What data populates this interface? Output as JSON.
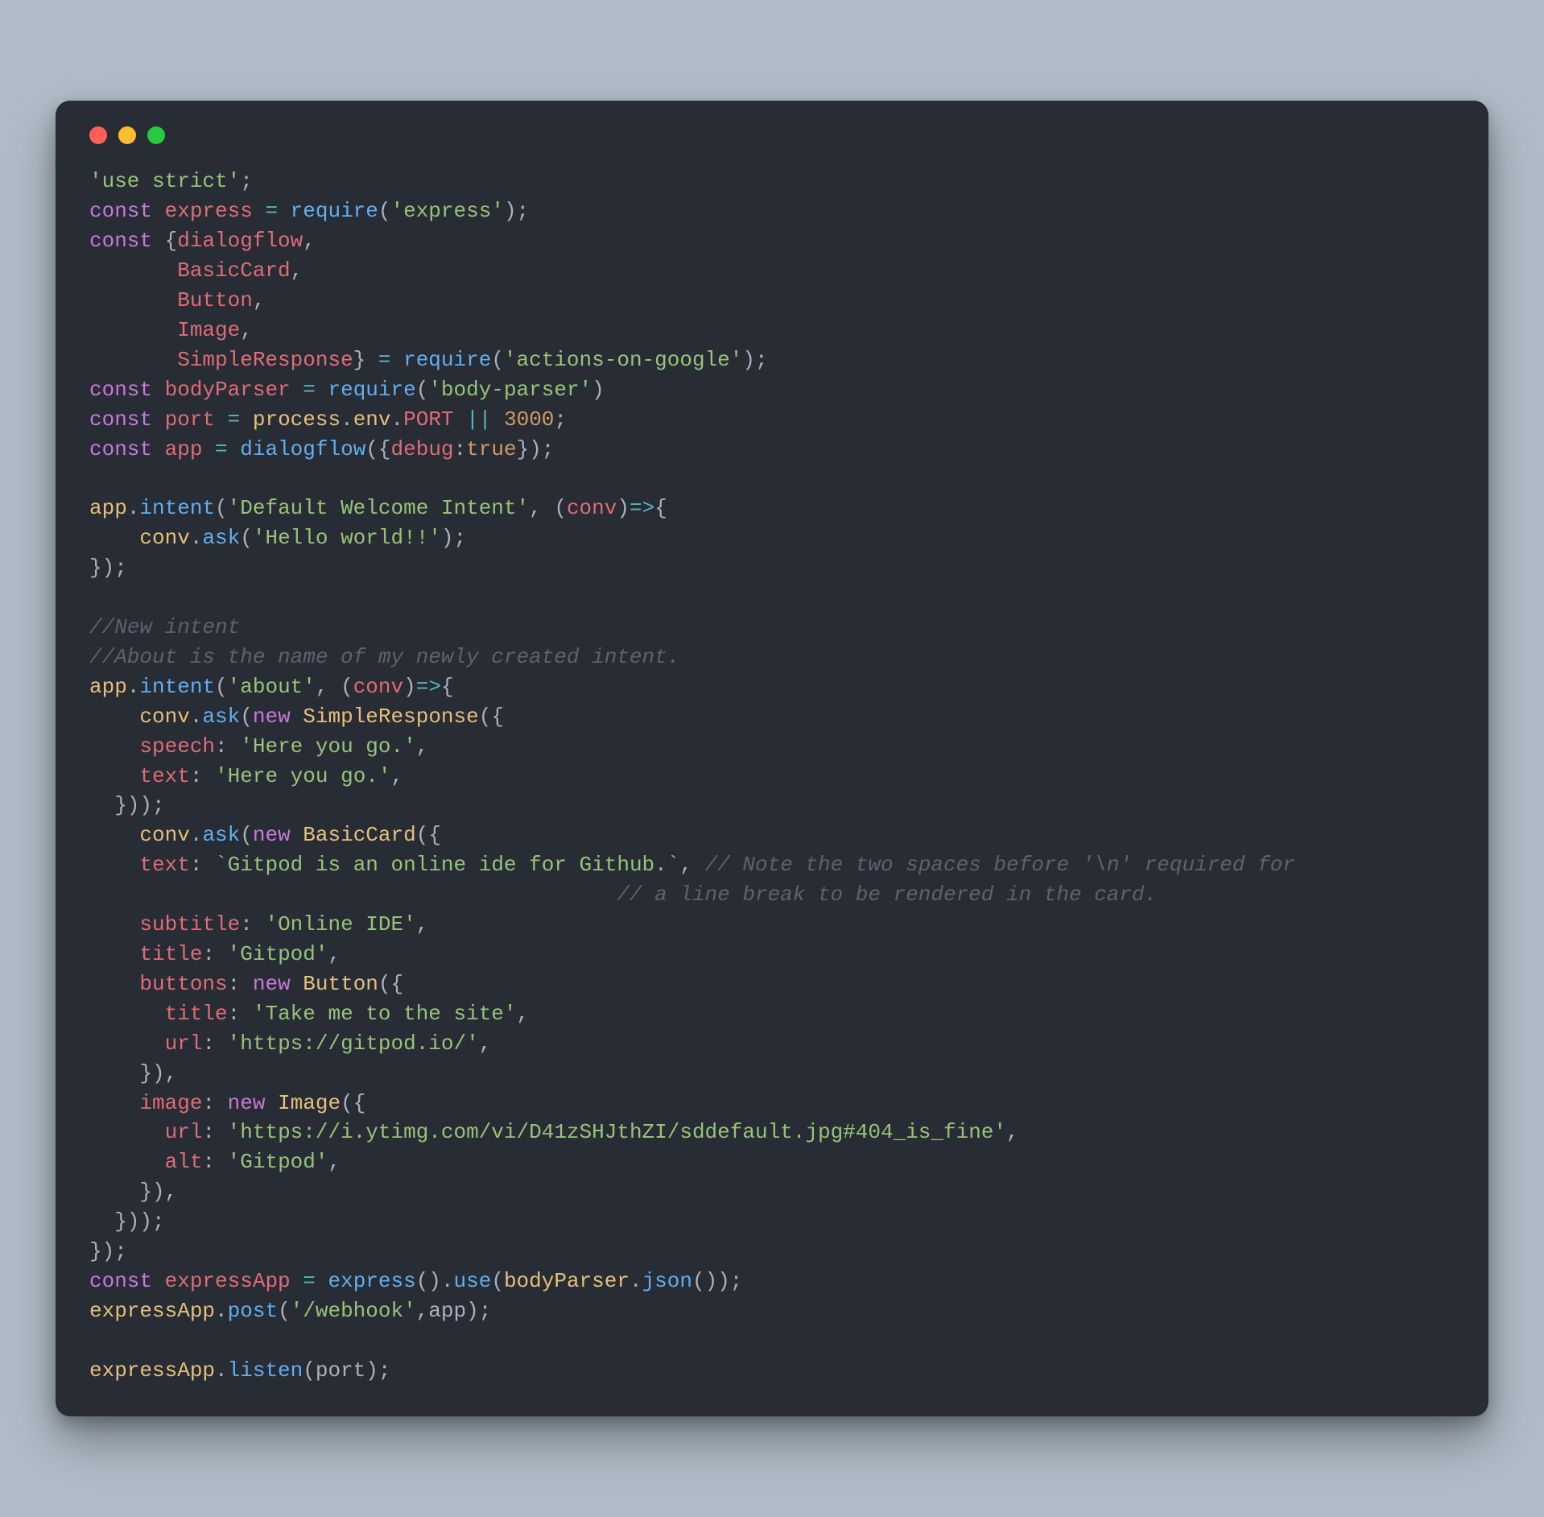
{
  "window": {
    "dots": [
      "red",
      "yellow",
      "green"
    ]
  },
  "code": {
    "l01_use_strict": "'use strict'",
    "l02_kw": "const",
    "l02_id": "express",
    "l02_fn": "require",
    "l02_arg": "'express'",
    "l03_kw": "const",
    "l03_id": "dialogflow",
    "l04_id": "BasicCard",
    "l05_id": "Button",
    "l06_id": "Image",
    "l07_id": "SimpleResponse",
    "l07_fn": "require",
    "l07_arg": "'actions-on-google'",
    "l08_kw": "const",
    "l08_id": "bodyParser",
    "l08_fn": "require",
    "l08_arg": "'body-parser'",
    "l09_kw": "const",
    "l09_id": "port",
    "l09_proc": "process",
    "l09_env": "env",
    "l09_port": "PORT",
    "l09_num": "3000",
    "l10_kw": "const",
    "l10_id": "app",
    "l10_fn": "dialogflow",
    "l10_key": "debug",
    "l10_val": "true",
    "l12_app": "app",
    "l12_intent": "intent",
    "l12_name": "'Default Welcome Intent'",
    "l12_param": "conv",
    "l13_conv": "conv",
    "l13_ask": "ask",
    "l13_msg": "'Hello world!!'",
    "c1": "//New intent",
    "c2": "//About is the name of my newly created intent.",
    "l18_app": "app",
    "l18_intent": "intent",
    "l18_name": "'about'",
    "l18_param": "conv",
    "l19_conv": "conv",
    "l19_ask": "ask",
    "l19_new": "new",
    "l19_cls": "SimpleResponse",
    "l20_key": "speech",
    "l20_val": "'Here you go.'",
    "l21_key": "text",
    "l21_val": "'Here you go.'",
    "l23_conv": "conv",
    "l23_ask": "ask",
    "l23_new": "new",
    "l23_cls": "BasicCard",
    "l24_key": "text",
    "l24_val": "`Gitpod is an online ide for Github.`",
    "l24_cmt": "// Note the two spaces before '\\n' required for",
    "l25_cmt": "// a line break to be rendered in the card.",
    "l26_key": "subtitle",
    "l26_val": "'Online IDE'",
    "l27_key": "title",
    "l27_val": "'Gitpod'",
    "l28_key": "buttons",
    "l28_new": "new",
    "l28_cls": "Button",
    "l29_key": "title",
    "l29_val": "'Take me to the site'",
    "l30_key": "url",
    "l30_val": "'https://gitpod.io/'",
    "l32_key": "image",
    "l32_new": "new",
    "l32_cls": "Image",
    "l33_key": "url",
    "l33_val": "'https://i.ytimg.com/vi/D41zSHJthZI/sddefault.jpg#404_is_fine'",
    "l34_key": "alt",
    "l34_val": "'Gitpod'",
    "l38_kw": "const",
    "l38_id": "expressApp",
    "l38_express": "express",
    "l38_use": "use",
    "l38_bp": "bodyParser",
    "l38_json": "json",
    "l39_ea": "expressApp",
    "l39_post": "post",
    "l39_path": "'/webhook'",
    "l39_app": "app",
    "l41_ea": "expressApp",
    "l41_listen": "listen",
    "l41_port": "port"
  }
}
